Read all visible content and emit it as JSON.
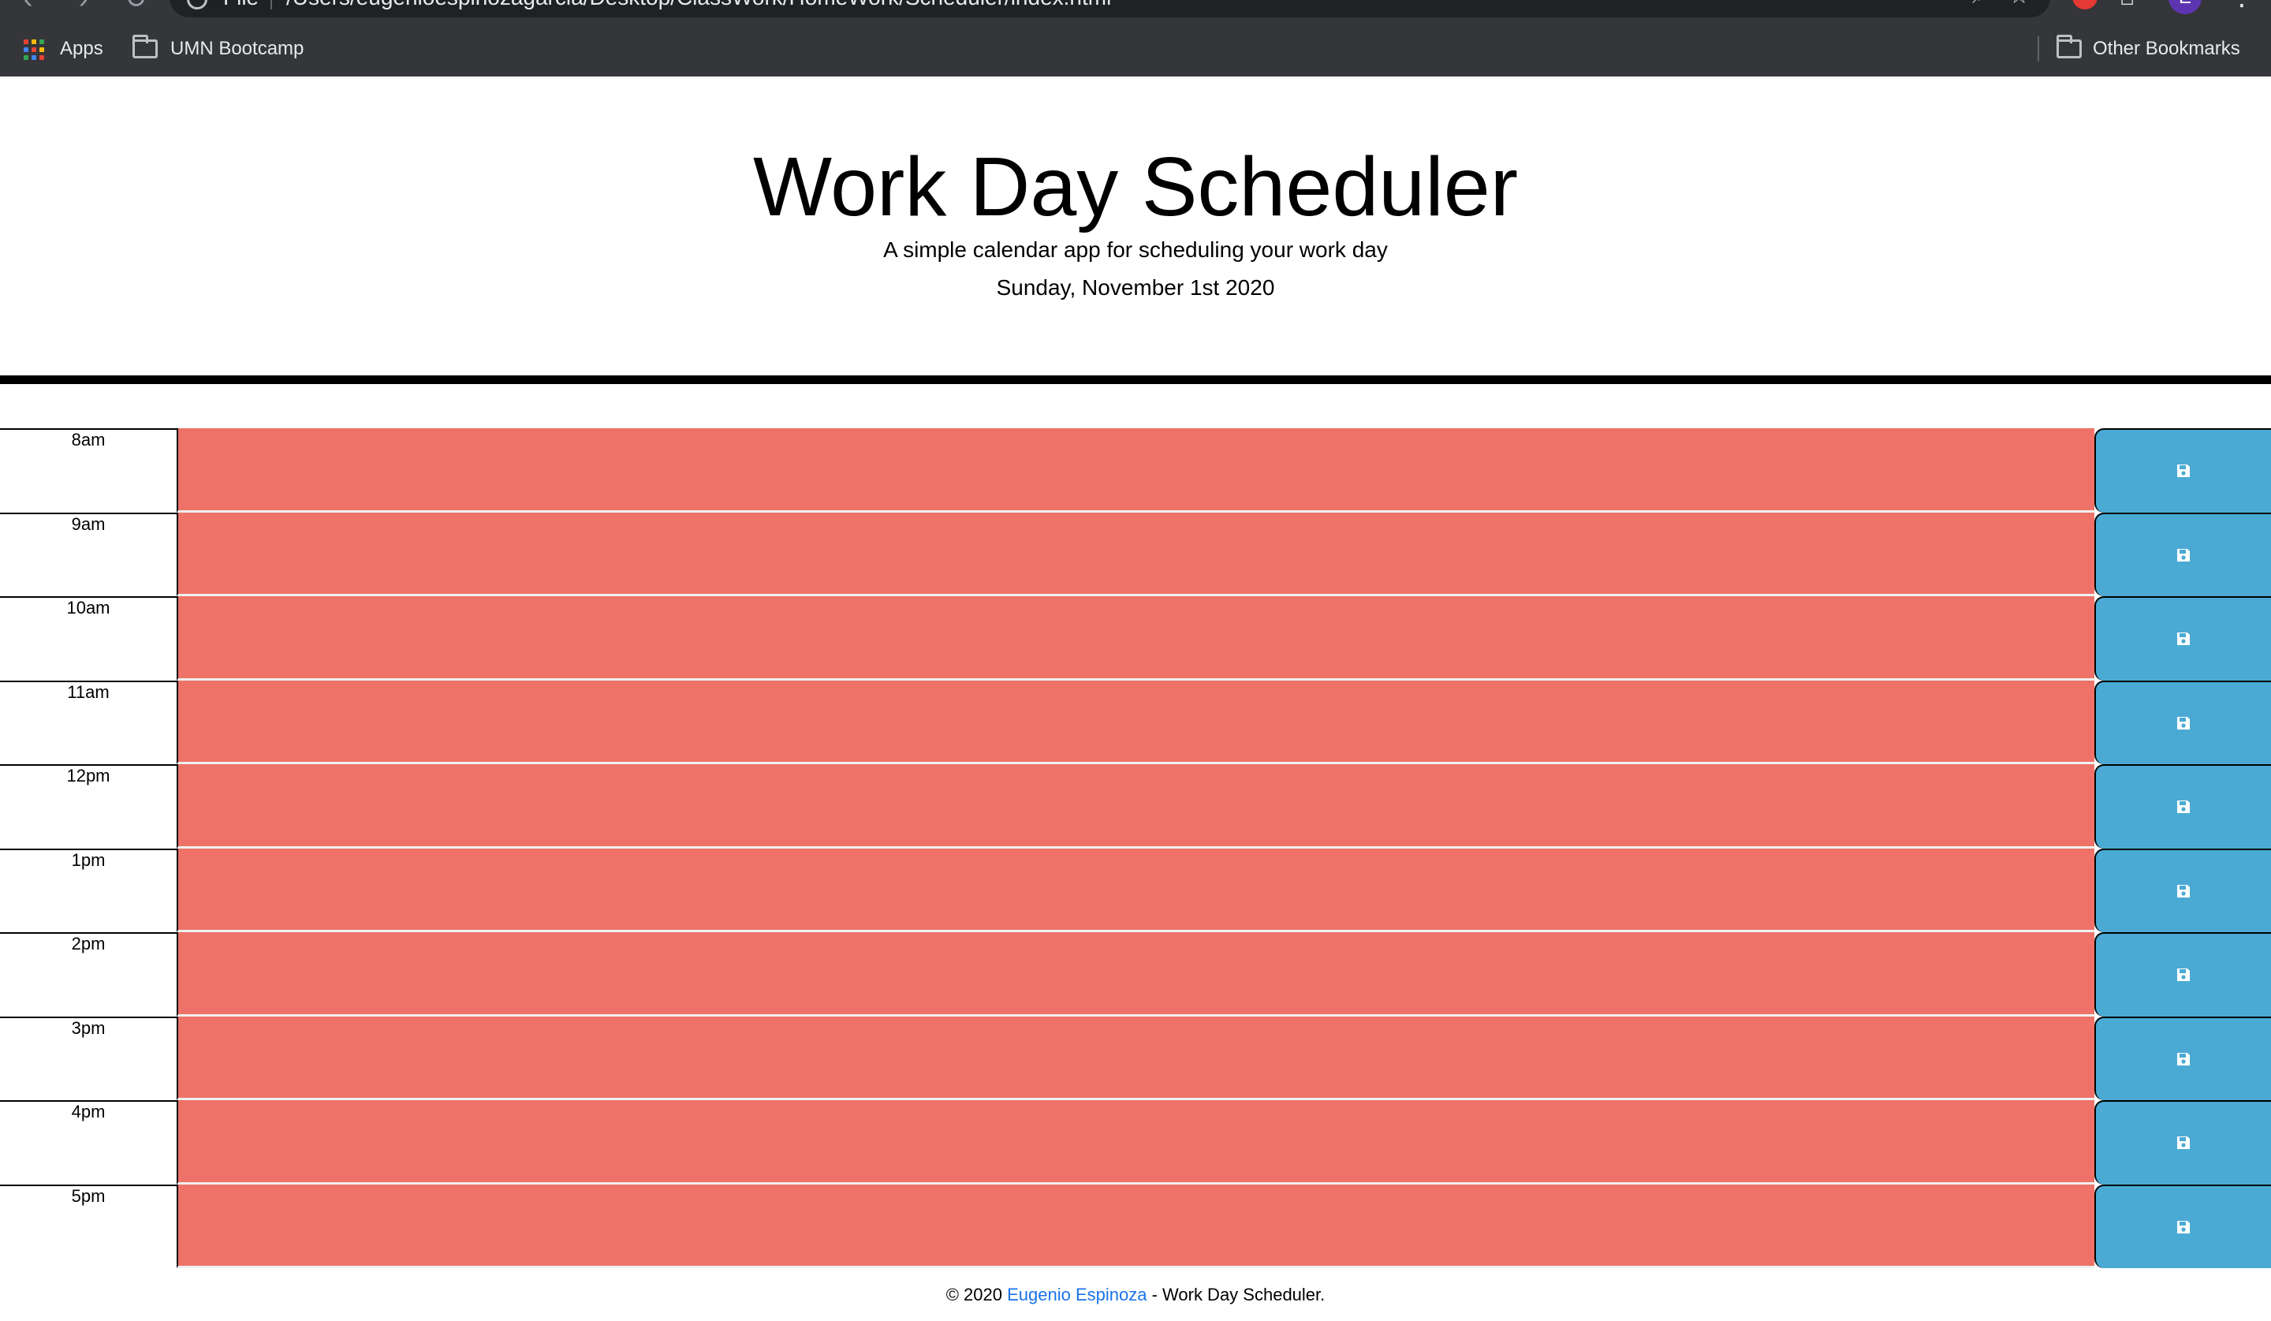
{
  "browser": {
    "url_scheme": "File",
    "url_path": "/Users/eugenioespinozagarcia/Desktop/ClassWork/HomeWork/Scheduler/index.html",
    "avatar_letter": "E",
    "bookmarks": {
      "apps_label": "Apps",
      "folder_label": "UMN Bootcamp",
      "other_label": "Other Bookmarks"
    }
  },
  "header": {
    "title": "Work Day Scheduler",
    "subtitle": "A simple calendar app for scheduling your work day",
    "current_day": "Sunday, November 1st 2020"
  },
  "colors": {
    "past": "#ee7268",
    "save": "#4aaad4",
    "link": "#1a73e8"
  },
  "timeblocks": [
    {
      "hour": "8am",
      "text": ""
    },
    {
      "hour": "9am",
      "text": ""
    },
    {
      "hour": "10am",
      "text": ""
    },
    {
      "hour": "11am",
      "text": ""
    },
    {
      "hour": "12pm",
      "text": ""
    },
    {
      "hour": "1pm",
      "text": ""
    },
    {
      "hour": "2pm",
      "text": ""
    },
    {
      "hour": "3pm",
      "text": ""
    },
    {
      "hour": "4pm",
      "text": ""
    },
    {
      "hour": "5pm",
      "text": ""
    }
  ],
  "footer": {
    "prefix": "© 2020 ",
    "author": "Eugenio Espinoza",
    "suffix": " - Work Day Scheduler."
  }
}
